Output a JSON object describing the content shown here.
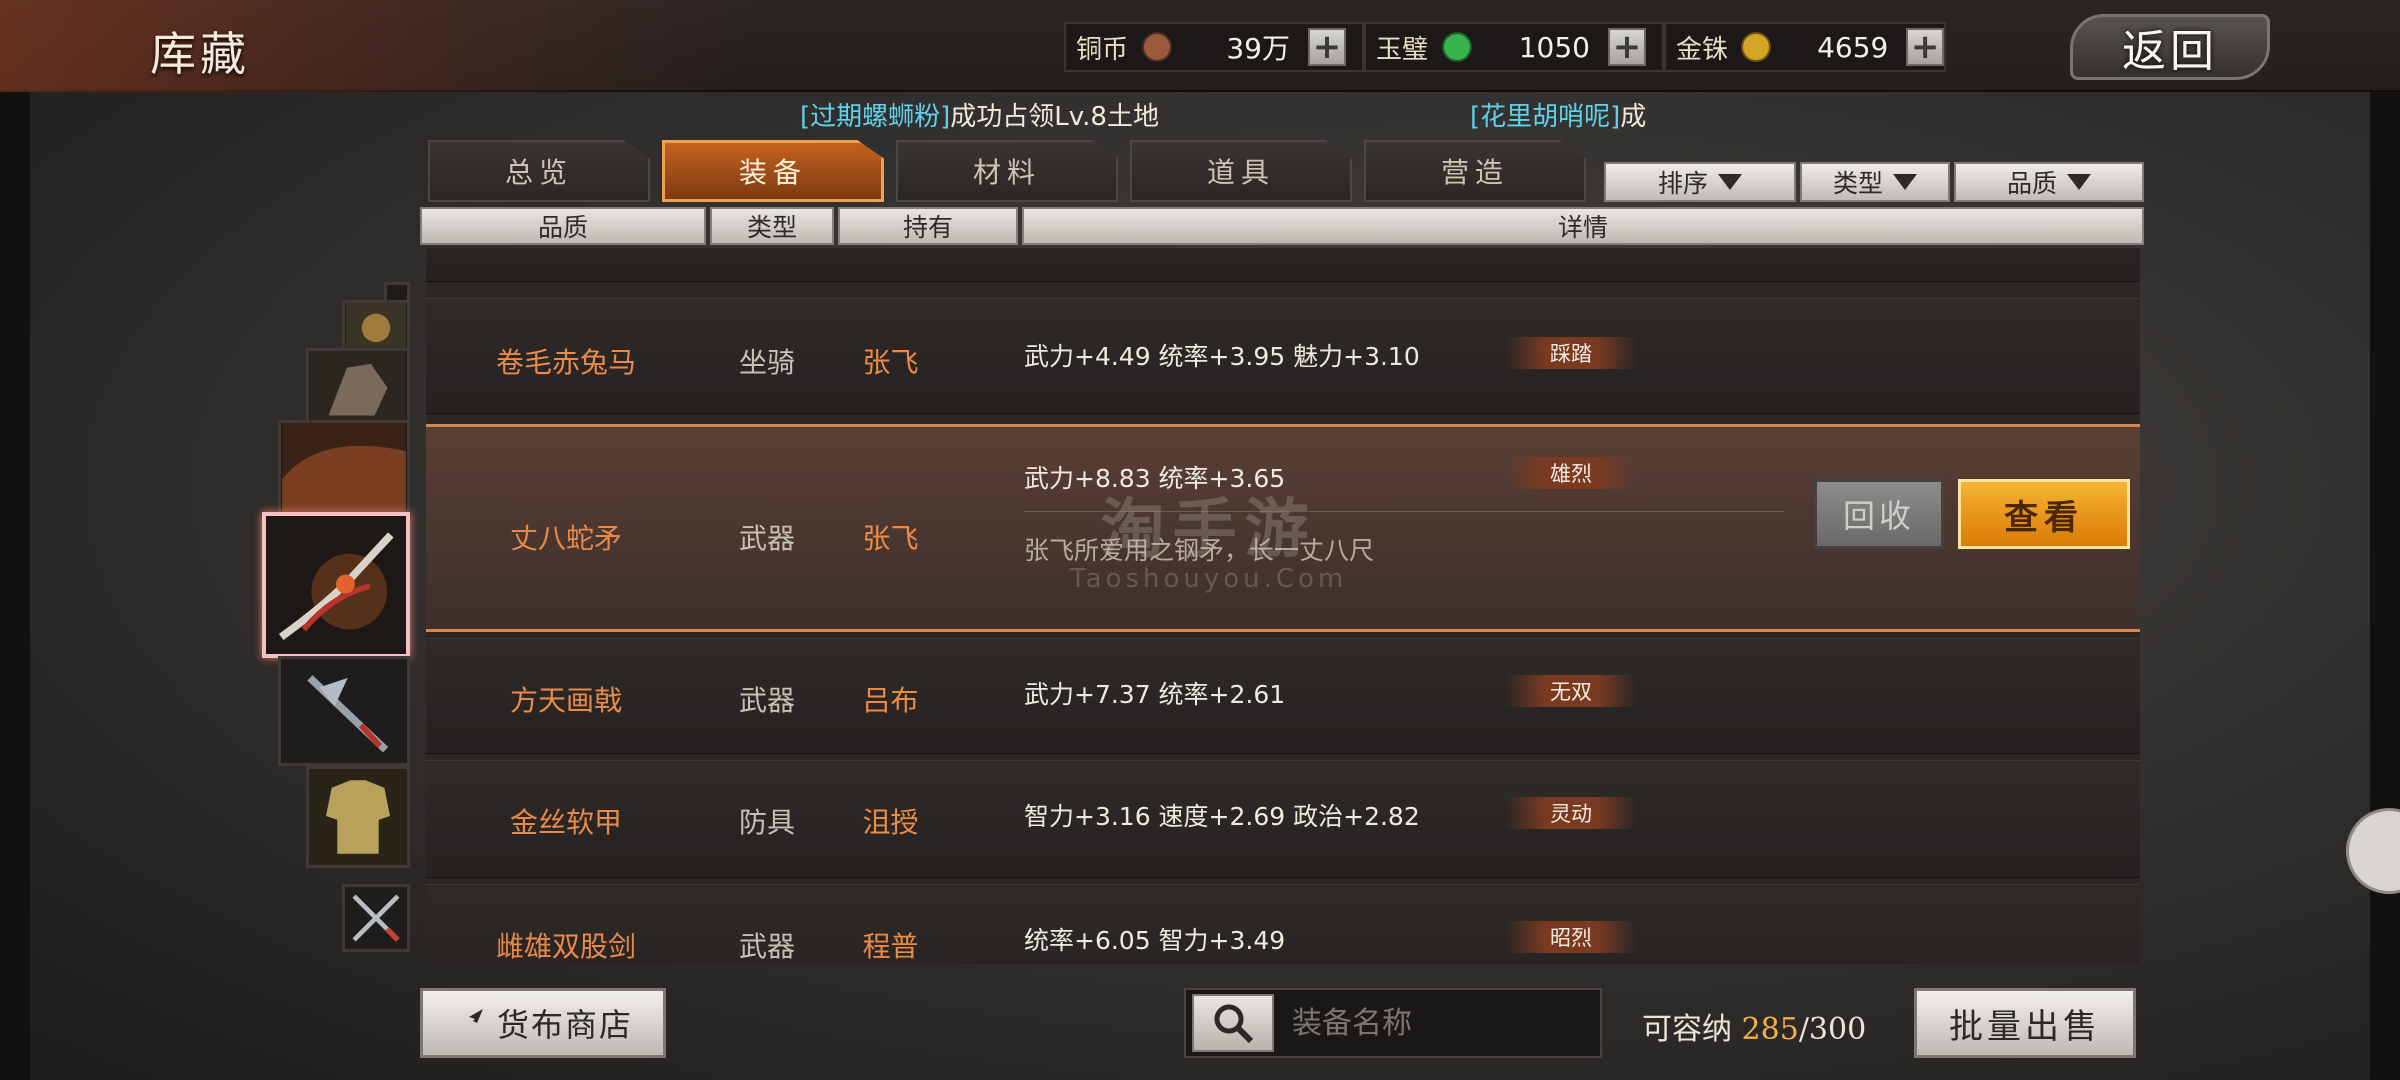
{
  "header": {
    "title": "库藏",
    "back_label": "返回"
  },
  "currencies": [
    {
      "label": "铜币",
      "value": "39万",
      "coin_color": "#9b5a3c"
    },
    {
      "label": "玉璧",
      "value": "1050",
      "coin_color": "#36b34a"
    },
    {
      "label": "金铢",
      "value": "4659",
      "coin_color": "#d6a426"
    }
  ],
  "ticker": [
    {
      "name": "[过期螺蛳粉]",
      "text": "成功占领Lv.8土地"
    },
    {
      "name": "[花里胡哨呢]",
      "text": "成"
    }
  ],
  "tabs": [
    "总览",
    "装备",
    "材料",
    "道具",
    "营造"
  ],
  "active_tab": "装备",
  "filters": [
    "排序",
    "类型",
    "品质"
  ],
  "columns": [
    "品质",
    "类型",
    "持有",
    "详情"
  ],
  "items": [
    {
      "name": "卷毛赤兔马",
      "type": "坐骑",
      "owner": "张飞",
      "stats": "武力+4.49  统率+3.95  魅力+3.10",
      "skill": "踩踏"
    },
    {
      "name": "丈八蛇矛",
      "type": "武器",
      "owner": "张飞",
      "stats": "武力+8.83  统率+3.65",
      "skill": "雄烈",
      "description": "张飞所爱用之钢矛，长一丈八尺",
      "selected": true
    },
    {
      "name": "方天画戟",
      "type": "武器",
      "owner": "吕布",
      "stats": "武力+7.37  统率+2.61",
      "skill": "无双"
    },
    {
      "name": "金丝软甲",
      "type": "防具",
      "owner": "沮授",
      "stats": "智力+3.16  速度+2.69  政治+2.82",
      "skill": "灵动"
    },
    {
      "name": "雌雄双股剑",
      "type": "武器",
      "owner": "程普",
      "stats": "统率+6.05  智力+3.49",
      "skill": "昭烈"
    }
  ],
  "actions": {
    "recycle": "回收",
    "view": "查看"
  },
  "watermark": {
    "cn": "淘手游",
    "en": "Taoshouyou.Com"
  },
  "bottom": {
    "shop_label": "货布商店",
    "search_placeholder": "装备名称",
    "capacity_label": "可容纳",
    "capacity_used": "285",
    "capacity_total": "/300",
    "bulk_sell_label": "批量出售"
  }
}
